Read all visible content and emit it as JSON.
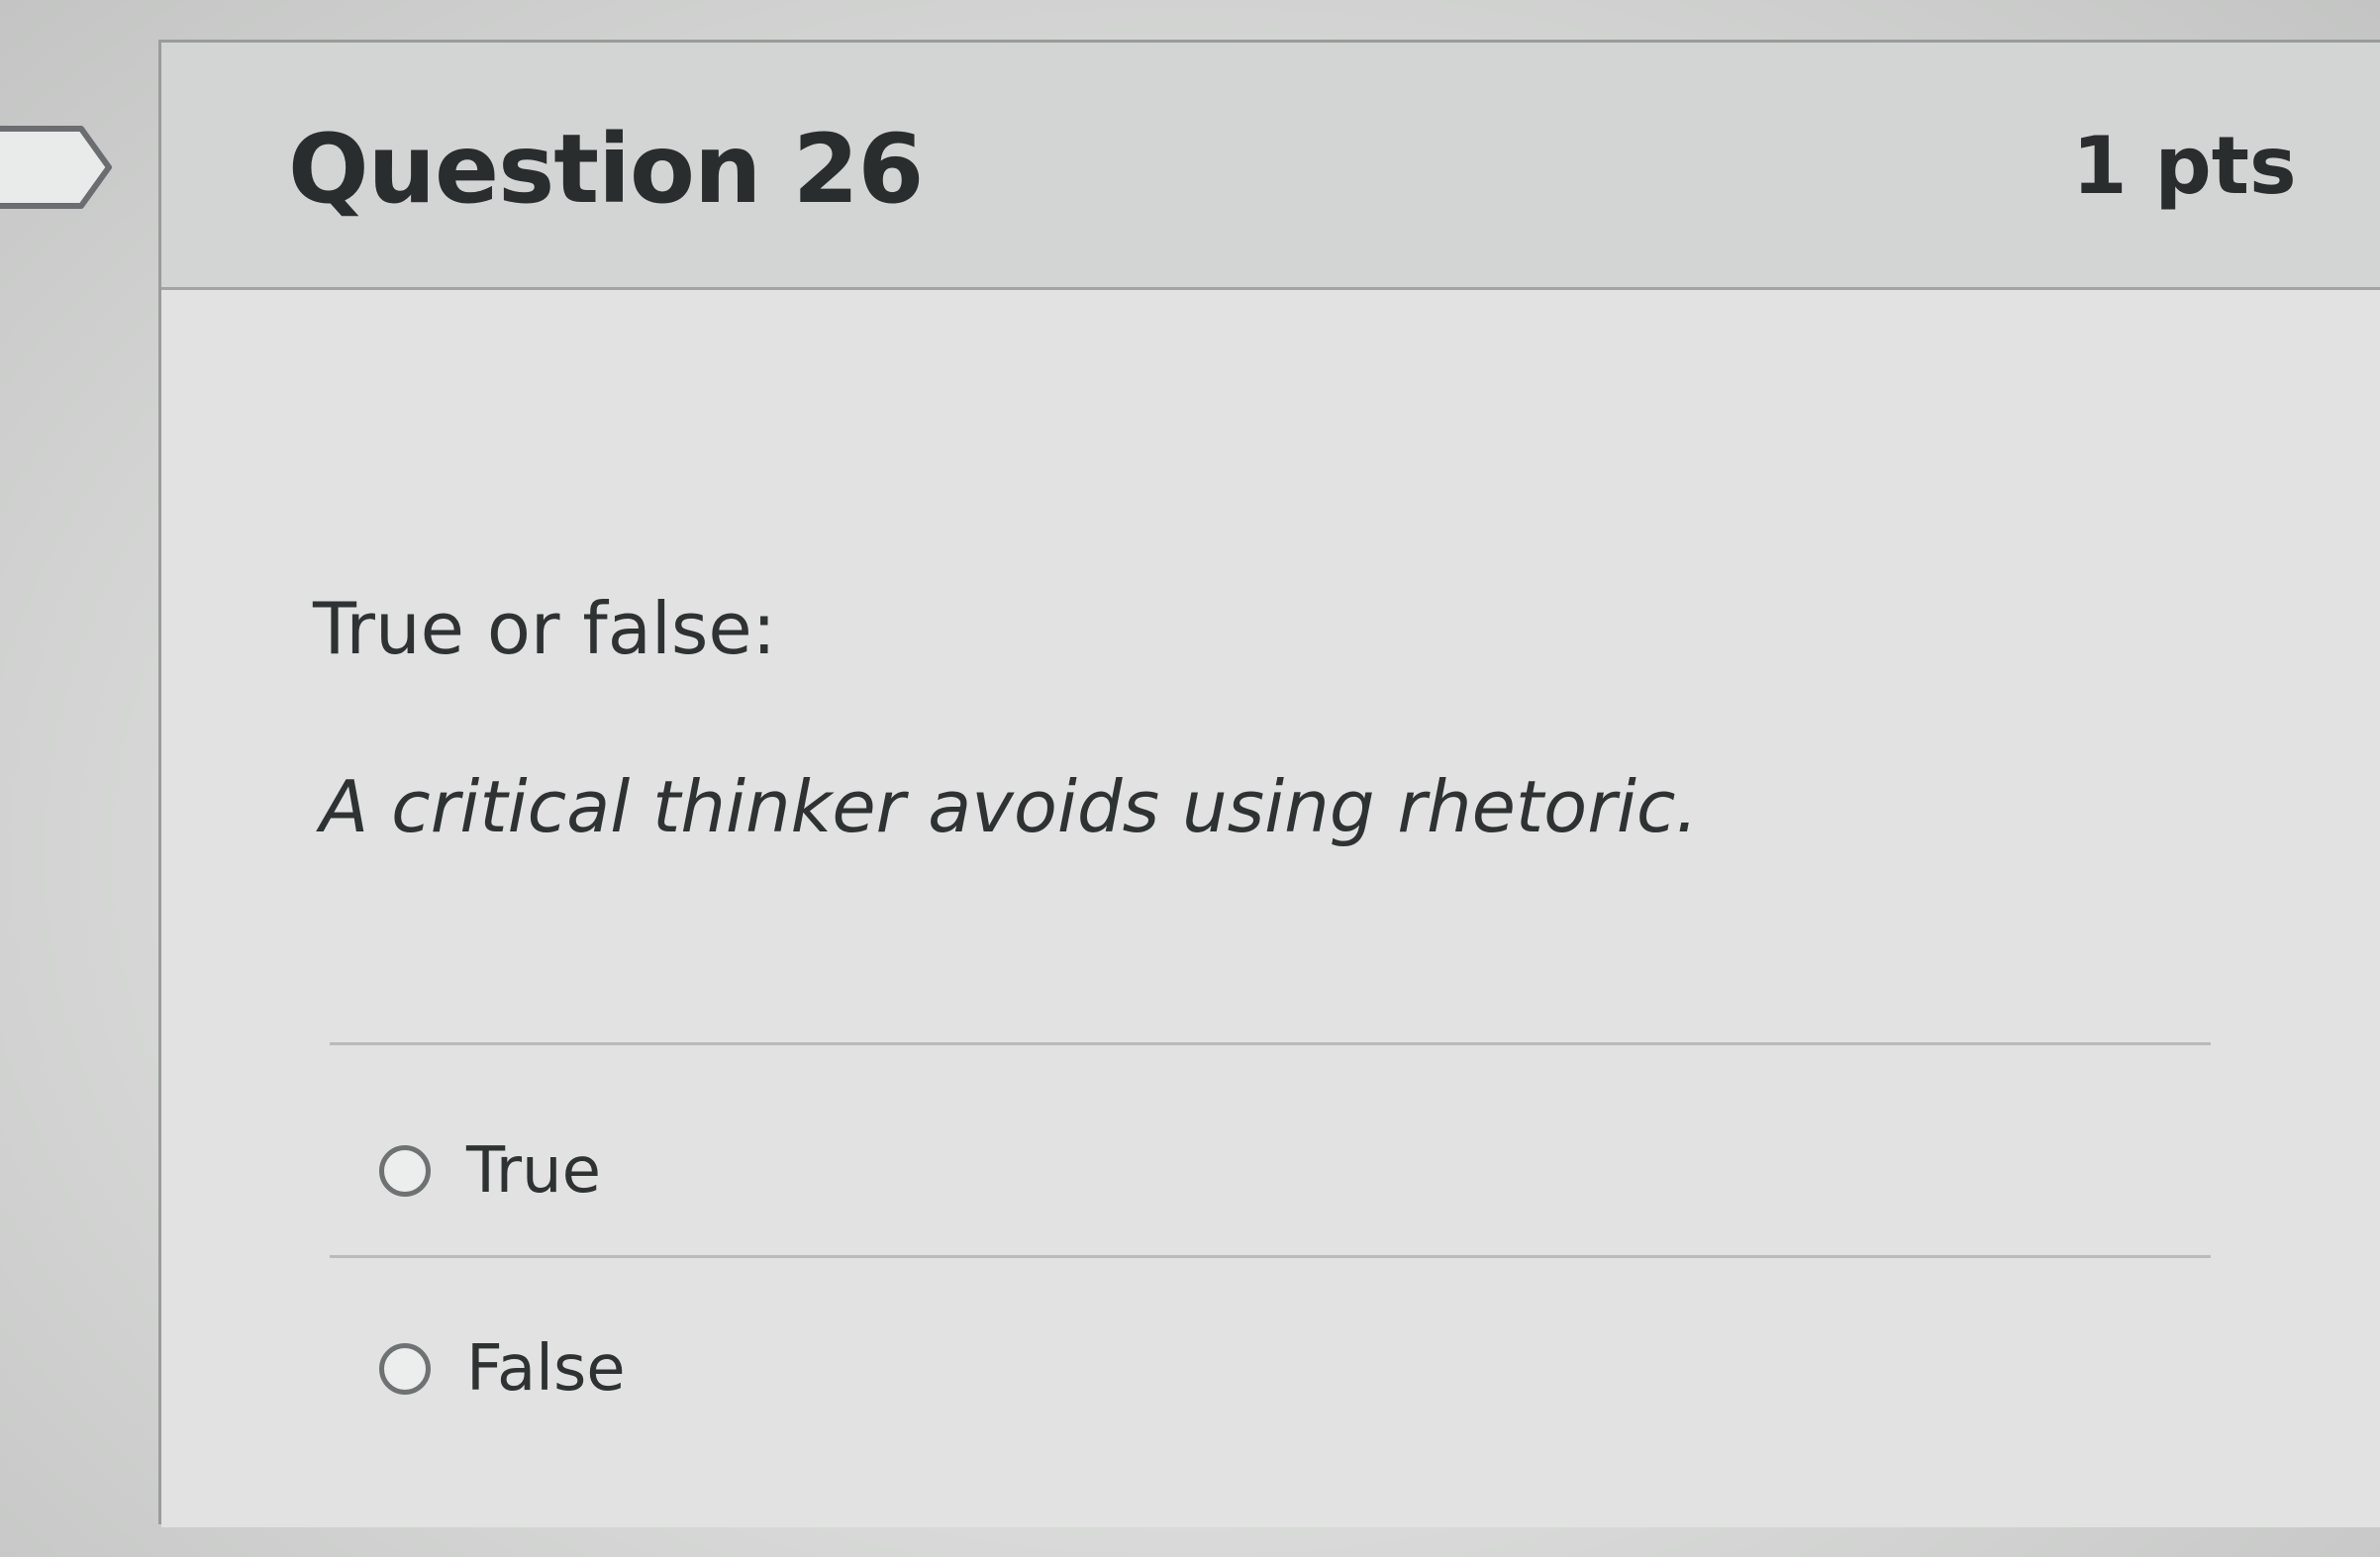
{
  "question": {
    "title": "Question 26",
    "points": "1 pts",
    "prompt_label": "True or false:",
    "statement": "A critical thinker avoids using rhetoric.",
    "answers": [
      {
        "label": "True",
        "selected": false
      },
      {
        "label": "False",
        "selected": false
      }
    ]
  },
  "icons": {
    "flag": "flag-icon"
  },
  "colors": {
    "header_bg": "#d3d4d4",
    "body_bg": "#e1e2e1",
    "text": "#2a2d2e",
    "border": "#9a9c9c"
  }
}
